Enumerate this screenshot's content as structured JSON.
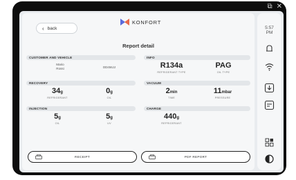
{
  "window": {
    "restore_icon": "restore-window-icon",
    "close_icon": "close-icon"
  },
  "header": {
    "back_label": "back",
    "logo_text": "KONFORT",
    "title": "Report detail"
  },
  "customer": {
    "section_label": "CUSTOMER AND VEHICLE",
    "name_first": "Mario",
    "name_last": "Rossi",
    "vehicle_code": "DD456JJ"
  },
  "info": {
    "section_label": "INFO",
    "refrigerant": {
      "value": "R134a",
      "caption": "REFRIGERANT TYPE"
    },
    "oil": {
      "value": "PAG",
      "caption": "OIL TYPE"
    }
  },
  "recovery": {
    "section_label": "RECOVERY",
    "refrigerant": {
      "value": "34",
      "unit": "g",
      "caption": "REFRIGERANT"
    },
    "oil": {
      "value": "0",
      "unit": "g",
      "caption": "OIL"
    }
  },
  "vacuum": {
    "section_label": "VACUUM",
    "time": {
      "value": "2",
      "unit": "min",
      "caption": "TIME"
    },
    "pressure": {
      "value": "11",
      "unit": "mbar",
      "caption": "PRESSURE"
    }
  },
  "injection": {
    "section_label": "INJECTION",
    "oil": {
      "value": "5",
      "unit": "g",
      "caption": "OIL"
    },
    "uv": {
      "value": "5",
      "unit": "g",
      "caption": "UV"
    }
  },
  "charge": {
    "section_label": "CHARGE",
    "refrigerant": {
      "value": "440",
      "unit": "g",
      "caption": "REFRIGERANT"
    }
  },
  "actions": {
    "receipt_label": "RECEIPT",
    "pdf_label": "PDF REPORT"
  },
  "sidebar": {
    "time_hm": "5:57",
    "time_ampm": "PM"
  }
}
